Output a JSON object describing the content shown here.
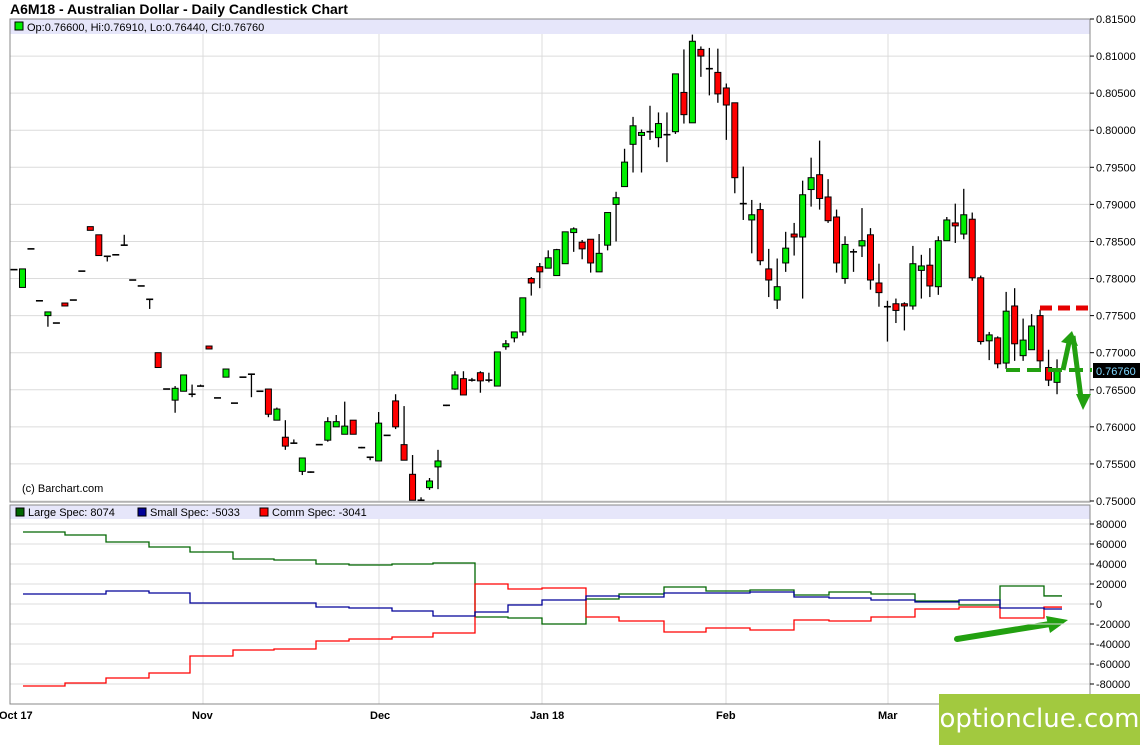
{
  "title": "A6M18 - Australian Dollar - Daily Candlestick Chart",
  "ohlc_header": "Op:0.76600, Hi:0.76910, Lo:0.76440, Cl:0.76760",
  "copyright": "(c) Barchart.com",
  "current_price_label": "0.76760",
  "watermark": "optionclue.com",
  "colors": {
    "up": "#00ee00",
    "down": "#ff0000",
    "large": "#006600",
    "small": "#000099",
    "comm": "#ff0000",
    "annot": "#22a010",
    "annot_red": "#e60000",
    "header_bg": "#e6e6fa",
    "watermark_bg": "#a2c93f"
  },
  "x_labels": [
    "Oct 17",
    "Nov",
    "Dec",
    "Jan 18",
    "Feb",
    "Mar"
  ],
  "legend": {
    "large": "Large Spec: 8074",
    "small": "Small Spec: -5033",
    "comm": "Comm Spec: -3041"
  },
  "chart_data": [
    {
      "type": "candlestick",
      "title": "A6M18 - Australian Dollar - Daily Candlestick Chart",
      "ylim": [
        0.75,
        0.815
      ],
      "y_ticks": [
        "0.75000",
        "0.75500",
        "0.76000",
        "0.76500",
        "0.77000",
        "0.77500",
        "0.78000",
        "0.78500",
        "0.79000",
        "0.79500",
        "0.80000",
        "0.80500",
        "0.81000",
        "0.81500"
      ],
      "ohlc": [
        [
          0.7812,
          0.7812,
          0.7812,
          0.7812
        ],
        [
          0.7788,
          0.7813,
          0.7788,
          0.7813
        ],
        [
          0.784,
          0.784,
          0.784,
          0.784
        ],
        [
          0.777,
          0.777,
          0.777,
          0.777
        ],
        [
          0.775,
          0.7755,
          0.7735,
          0.7755
        ],
        [
          0.774,
          0.774,
          0.774,
          0.774
        ],
        [
          0.7767,
          0.7767,
          0.7763,
          0.7763
        ],
        [
          0.7771,
          0.7771,
          0.7771,
          0.7771
        ],
        [
          0.781,
          0.781,
          0.781,
          0.781
        ],
        [
          0.787,
          0.787,
          0.7865,
          0.7865
        ],
        [
          0.7859,
          0.7859,
          0.7831,
          0.7831
        ],
        [
          0.783,
          0.783,
          0.7823,
          0.783
        ],
        [
          0.7832,
          0.7832,
          0.7832,
          0.7832
        ],
        [
          0.7845,
          0.7859,
          0.7845,
          0.7845
        ],
        [
          0.7798,
          0.7798,
          0.7798,
          0.7798
        ],
        [
          0.779,
          0.779,
          0.779,
          0.779
        ],
        [
          0.7772,
          0.7772,
          0.7759,
          0.7772
        ],
        [
          0.77,
          0.77,
          0.768,
          0.768
        ],
        [
          0.7651,
          0.7651,
          0.7651,
          0.7651
        ],
        [
          0.7636,
          0.7655,
          0.7619,
          0.7652
        ],
        [
          0.7648,
          0.767,
          0.7648,
          0.767
        ],
        [
          0.7644,
          0.7657,
          0.764,
          0.7644
        ],
        [
          0.7655,
          0.7657,
          0.7655,
          0.7655
        ],
        [
          0.7709,
          0.7709,
          0.7705,
          0.7705
        ],
        [
          0.7639,
          0.7639,
          0.7639,
          0.7639
        ],
        [
          0.7667,
          0.7678,
          0.7667,
          0.7678
        ],
        [
          0.7632,
          0.7632,
          0.7632,
          0.7632
        ],
        [
          0.7667,
          0.7667,
          0.7667,
          0.7667
        ],
        [
          0.7671,
          0.7672,
          0.764,
          0.7671
        ],
        [
          0.7648,
          0.7648,
          0.7648,
          0.7648
        ],
        [
          0.7651,
          0.7651,
          0.7613,
          0.7617
        ],
        [
          0.7609,
          0.7626,
          0.7609,
          0.7624
        ],
        [
          0.7586,
          0.7609,
          0.7569,
          0.7574
        ],
        [
          0.7578,
          0.7583,
          0.7578,
          0.7578
        ],
        [
          0.754,
          0.7558,
          0.7535,
          0.7558
        ],
        [
          0.754,
          0.754,
          0.7538,
          0.7538
        ],
        [
          0.7576,
          0.7576,
          0.7576,
          0.7576
        ],
        [
          0.7582,
          0.7613,
          0.758,
          0.7607
        ],
        [
          0.76,
          0.7616,
          0.76,
          0.7607
        ],
        [
          0.759,
          0.7634,
          0.759,
          0.7601
        ],
        [
          0.7609,
          0.7609,
          0.759,
          0.759
        ],
        [
          0.7572,
          0.7573,
          0.7571,
          0.7572
        ],
        [
          0.7559,
          0.7559,
          0.7555,
          0.7559
        ],
        [
          0.7554,
          0.762,
          0.7554,
          0.7605
        ],
        [
          0.7589,
          0.7589,
          0.7588,
          0.7588
        ],
        [
          0.7635,
          0.7644,
          0.7597,
          0.76
        ],
        [
          0.7576,
          0.7628,
          0.7555,
          0.7555
        ],
        [
          0.7536,
          0.7562,
          0.7501,
          0.7501
        ],
        [
          0.7501,
          0.7505,
          0.7501,
          0.7501
        ],
        [
          0.7518,
          0.7531,
          0.7515,
          0.7527
        ],
        [
          0.7546,
          0.7569,
          0.7516,
          0.7554
        ],
        [
          0.7628,
          0.763,
          0.7628,
          0.763
        ],
        [
          0.7651,
          0.7675,
          0.765,
          0.767
        ],
        [
          0.7665,
          0.7675,
          0.7643,
          0.7643
        ],
        [
          0.7663,
          0.7666,
          0.7661,
          0.7663
        ],
        [
          0.7673,
          0.7675,
          0.7646,
          0.7662
        ],
        [
          0.7663,
          0.7673,
          0.766,
          0.7663
        ],
        [
          0.7655,
          0.7701,
          0.7655,
          0.7701
        ],
        [
          0.7708,
          0.7717,
          0.7704,
          0.7712
        ],
        [
          0.772,
          0.7728,
          0.7714,
          0.7728
        ],
        [
          0.7728,
          0.7774,
          0.7723,
          0.7774
        ],
        [
          0.78,
          0.7802,
          0.7777,
          0.7794
        ],
        [
          0.7816,
          0.7821,
          0.7787,
          0.7809
        ],
        [
          0.7814,
          0.7838,
          0.7814,
          0.7828
        ],
        [
          0.7804,
          0.784,
          0.7804,
          0.7839
        ],
        [
          0.782,
          0.7863,
          0.782,
          0.7863
        ],
        [
          0.7862,
          0.7869,
          0.7836,
          0.7867
        ],
        [
          0.7849,
          0.7852,
          0.7826,
          0.784
        ],
        [
          0.7853,
          0.7853,
          0.7808,
          0.7821
        ],
        [
          0.7809,
          0.786,
          0.7809,
          0.7834
        ],
        [
          0.7845,
          0.7889,
          0.7838,
          0.7889
        ],
        [
          0.79,
          0.7917,
          0.785,
          0.7909
        ],
        [
          0.7924,
          0.7975,
          0.7924,
          0.7957
        ],
        [
          0.7981,
          0.8018,
          0.7943,
          0.8006
        ],
        [
          0.7993,
          0.8001,
          0.7943,
          0.7997
        ],
        [
          0.7998,
          0.8033,
          0.7987,
          0.7998
        ],
        [
          0.799,
          0.8024,
          0.7977,
          0.8009
        ],
        [
          0.7994,
          0.8024,
          0.7957,
          0.7994
        ],
        [
          0.7998,
          0.8076,
          0.7995,
          0.8076
        ],
        [
          0.8051,
          0.8109,
          0.8009,
          0.8021
        ],
        [
          0.801,
          0.8129,
          0.801,
          0.812
        ],
        [
          0.8109,
          0.8113,
          0.8072,
          0.81
        ],
        [
          0.8083,
          0.8111,
          0.8047,
          0.8083
        ],
        [
          0.8078,
          0.811,
          0.8037,
          0.8049
        ],
        [
          0.8057,
          0.8063,
          0.7987,
          0.8034
        ],
        [
          0.8037,
          0.8037,
          0.7915,
          0.7936
        ],
        [
          0.7901,
          0.7951,
          0.7879,
          0.7901
        ],
        [
          0.7879,
          0.7906,
          0.7834,
          0.7886
        ],
        [
          0.7893,
          0.7902,
          0.7818,
          0.7824
        ],
        [
          0.7813,
          0.784,
          0.7775,
          0.7798
        ],
        [
          0.7771,
          0.7827,
          0.7759,
          0.7789
        ],
        [
          0.7821,
          0.7863,
          0.7809,
          0.7841
        ],
        [
          0.786,
          0.7875,
          0.7831,
          0.7856
        ],
        [
          0.7856,
          0.7932,
          0.7773,
          0.7913
        ],
        [
          0.792,
          0.7963,
          0.7897,
          0.7936
        ],
        [
          0.794,
          0.7986,
          0.7893,
          0.7908
        ],
        [
          0.791,
          0.7934,
          0.7875,
          0.7878
        ],
        [
          0.7883,
          0.7893,
          0.7808,
          0.7821
        ],
        [
          0.78,
          0.7857,
          0.7793,
          0.7846
        ],
        [
          0.7836,
          0.784,
          0.7809,
          0.7836
        ],
        [
          0.7844,
          0.7895,
          0.7829,
          0.7851
        ],
        [
          0.7859,
          0.7868,
          0.7785,
          0.7798
        ],
        [
          0.7794,
          0.782,
          0.7762,
          0.7781
        ],
        [
          0.7762,
          0.777,
          0.7715,
          0.7762
        ],
        [
          0.7766,
          0.7773,
          0.774,
          0.7757
        ],
        [
          0.7766,
          0.7768,
          0.773,
          0.7763
        ],
        [
          0.7763,
          0.7844,
          0.7758,
          0.782
        ],
        [
          0.7811,
          0.7832,
          0.7773,
          0.7817
        ],
        [
          0.7818,
          0.7841,
          0.7775,
          0.779
        ],
        [
          0.7789,
          0.7857,
          0.7778,
          0.7851
        ],
        [
          0.7851,
          0.7883,
          0.7851,
          0.7879
        ],
        [
          0.7875,
          0.7901,
          0.7848,
          0.7871
        ],
        [
          0.786,
          0.7921,
          0.7853,
          0.7886
        ],
        [
          0.788,
          0.7889,
          0.7797,
          0.7801
        ],
        [
          0.7801,
          0.7804,
          0.7711,
          0.7715
        ],
        [
          0.7716,
          0.7728,
          0.769,
          0.7724
        ],
        [
          0.772,
          0.7722,
          0.7679,
          0.7685
        ],
        [
          0.7686,
          0.7782,
          0.7678,
          0.7756
        ],
        [
          0.7763,
          0.7787,
          0.7689,
          0.7712
        ],
        [
          0.7696,
          0.7746,
          0.7689,
          0.7717
        ],
        [
          0.7704,
          0.7752,
          0.7704,
          0.7736
        ],
        [
          0.775,
          0.7758,
          0.7679,
          0.7689
        ],
        [
          0.768,
          0.7704,
          0.7655,
          0.7663
        ],
        [
          0.766,
          0.7691,
          0.7644,
          0.7676
        ]
      ],
      "annotations": {
        "resistance_level": 0.776,
        "support_level": 0.7676
      }
    },
    {
      "type": "line",
      "title": "Commitment of Traders",
      "ylim": [
        -90000,
        90000
      ],
      "y_ticks": [
        "80000",
        "60000",
        "40000",
        "20000",
        "0",
        "-20000",
        "-40000",
        "-60000",
        "-80000"
      ],
      "series": [
        {
          "name": "Large Spec",
          "values": [
            72000,
            69000,
            62000,
            57000,
            52000,
            45000,
            44000,
            40000,
            39000,
            40000,
            41000,
            -13000,
            -14000,
            -20000,
            5000,
            10000,
            17000,
            13000,
            14000,
            9000,
            12000,
            10000,
            3000,
            -1000,
            18000,
            8074
          ]
        },
        {
          "name": "Small Spec",
          "values": [
            10000,
            10000,
            13000,
            11000,
            1000,
            1000,
            1000,
            -3000,
            -4000,
            -7000,
            -12000,
            -8000,
            -1000,
            4000,
            8000,
            7000,
            11000,
            11000,
            12000,
            7000,
            6000,
            4000,
            2000,
            4000,
            -4000,
            -5033
          ]
        },
        {
          "name": "Comm Spec",
          "values": [
            -82000,
            -79000,
            -74000,
            -69000,
            -52000,
            -46000,
            -45000,
            -37000,
            -35000,
            -33000,
            -29000,
            20000,
            15000,
            16000,
            -13000,
            -17000,
            -28000,
            -24000,
            -26000,
            -16000,
            -17000,
            -13000,
            -5000,
            -3000,
            -14000,
            -3041
          ]
        }
      ]
    }
  ]
}
